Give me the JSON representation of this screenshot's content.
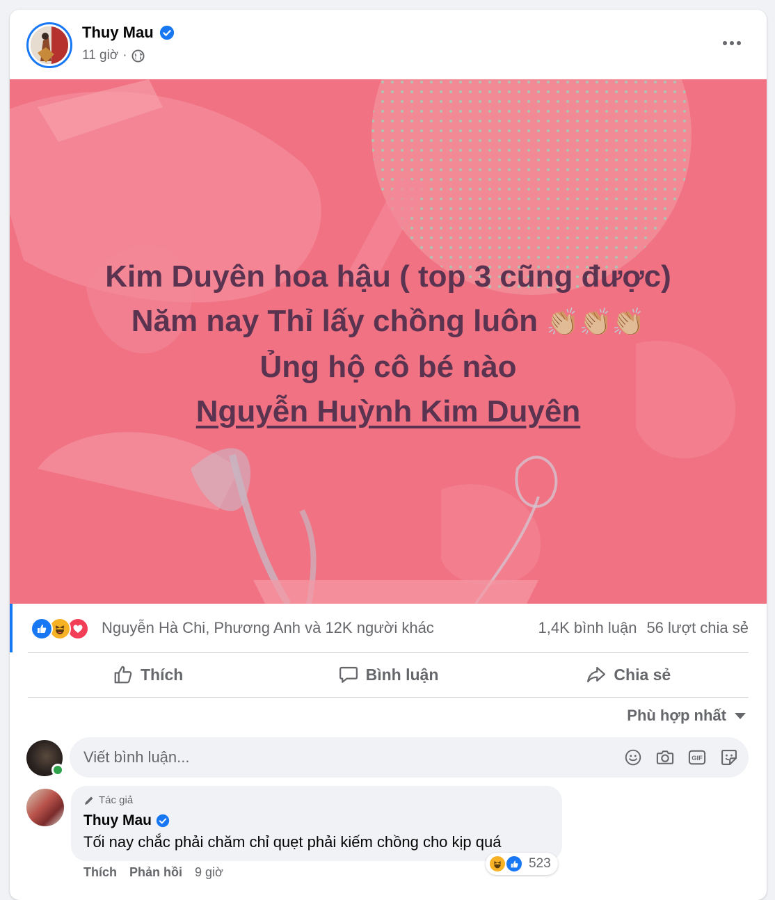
{
  "post": {
    "author": "Thuy Mau",
    "time": "11 giờ",
    "separator": "·",
    "privacy_icon": "globe-icon",
    "lines": [
      "Kim Duyên hoa hậu ( top 3 cũng được)",
      "Năm nay Thỉ lấy chồng luôn",
      "Ủng hộ cô bé nào",
      "Nguyễn Huỳnh Kim Duyên"
    ],
    "emoji": "👏🏼👏🏼👏🏼",
    "background_color": "#f07283",
    "text_color": "#5a3350"
  },
  "reactions": {
    "types": [
      "like",
      "haha",
      "love"
    ],
    "names": "Nguyễn Hà Chi, Phương Anh và 12K người khác",
    "comments": "1,4K bình luận",
    "shares": "56 lượt chia sẻ"
  },
  "actions": {
    "like": "Thích",
    "comment": "Bình luận",
    "share": "Chia sẻ"
  },
  "sort": {
    "label": "Phù hợp nhất"
  },
  "comment_box": {
    "placeholder": "Viết bình luận..."
  },
  "comment": {
    "badge": "Tác giả",
    "author": "Thuy Mau",
    "text": "Tối nay chắc phải chăm chỉ quẹt phải kiếm chồng cho kịp quá",
    "reaction_count": "523",
    "like": "Thích",
    "reply": "Phản hồi",
    "time": "9 giờ"
  },
  "colors": {
    "accent": "#1877f2",
    "secondary_text": "#65676b"
  }
}
